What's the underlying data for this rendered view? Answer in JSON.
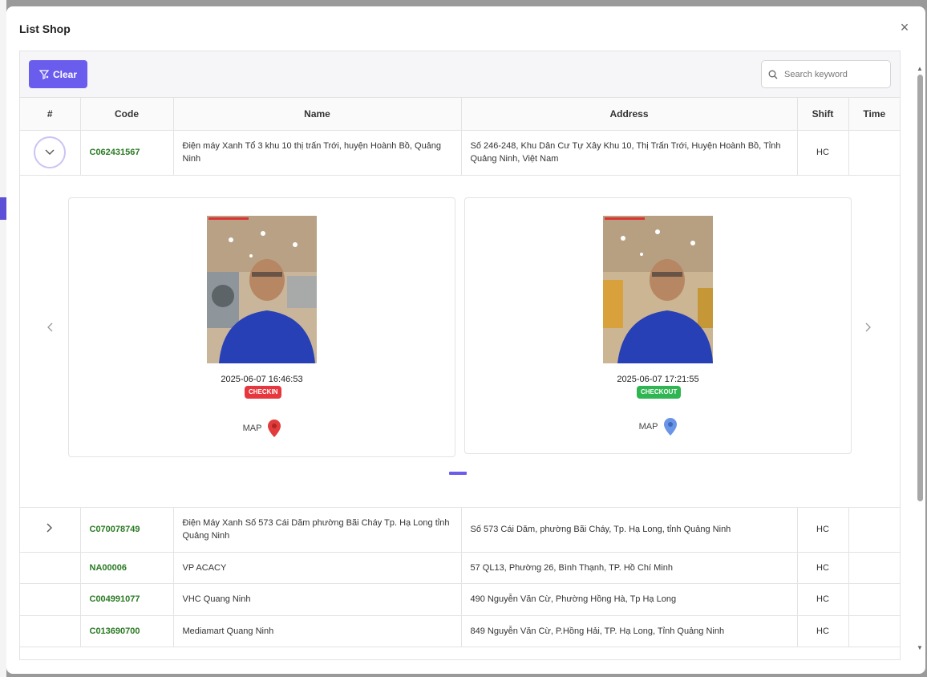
{
  "modal": {
    "title": "List Shop",
    "close": "×"
  },
  "toolbar": {
    "clear_label": "Clear",
    "search_placeholder": "Search keyword"
  },
  "columns": [
    "#",
    "Code",
    "Name",
    "Address",
    "Shift",
    "Time"
  ],
  "expanded_row": {
    "code": "C062431567",
    "name": "Điện máy Xanh Tổ 3 khu 10 thị trấn Trới, huyện Hoành Bồ, Quảng Ninh",
    "address": "Số 246-248, Khu Dân Cư Tự Xây Khu 10, Thị Trấn Trới, Huyện Hoành Bồ, Tỉnh Quảng Ninh, Việt Nam",
    "shift": "HC",
    "time": "",
    "checkin": {
      "time": "2025-06-07 16:46:53",
      "badge": "CHECKIN",
      "map": "MAP",
      "badge_color": "#e5373d",
      "pin_color": "#e23b3b"
    },
    "checkout": {
      "time": "2025-06-07 17:21:55",
      "badge": "CHECKOUT",
      "map": "MAP",
      "badge_color": "#2fb552",
      "pin_color": "#6a94e6"
    }
  },
  "rows": [
    {
      "code": "C070078749",
      "name": "Điện Máy Xanh Số 573 Cái Dăm phường Bãi Cháy Tp. Hạ Long tỉnh Quảng Ninh",
      "address": "Số 573 Cái Dăm, phường Bãi Cháy, Tp. Hạ Long, tỉnh Quảng Ninh",
      "shift": "HC",
      "time": ""
    },
    {
      "code": "NA00006",
      "name": "VP ACACY",
      "address": "57 QL13, Phường 26, Bình Thạnh, TP. Hồ Chí Minh",
      "shift": "HC",
      "time": ""
    },
    {
      "code": "C004991077",
      "name": "VHC Quang Ninh",
      "address": "490 Nguyễn Văn Cừ, Phường Hồng Hà, Tp Hạ Long",
      "shift": "HC",
      "time": ""
    },
    {
      "code": "C013690700",
      "name": "Mediamart Quang Ninh",
      "address": "849 Nguyễn Văn Cừ, P.Hồng Hải, TP. Hạ Long, Tỉnh Quảng Ninh",
      "shift": "HC",
      "time": ""
    }
  ],
  "brand_color": "#6a5ced"
}
